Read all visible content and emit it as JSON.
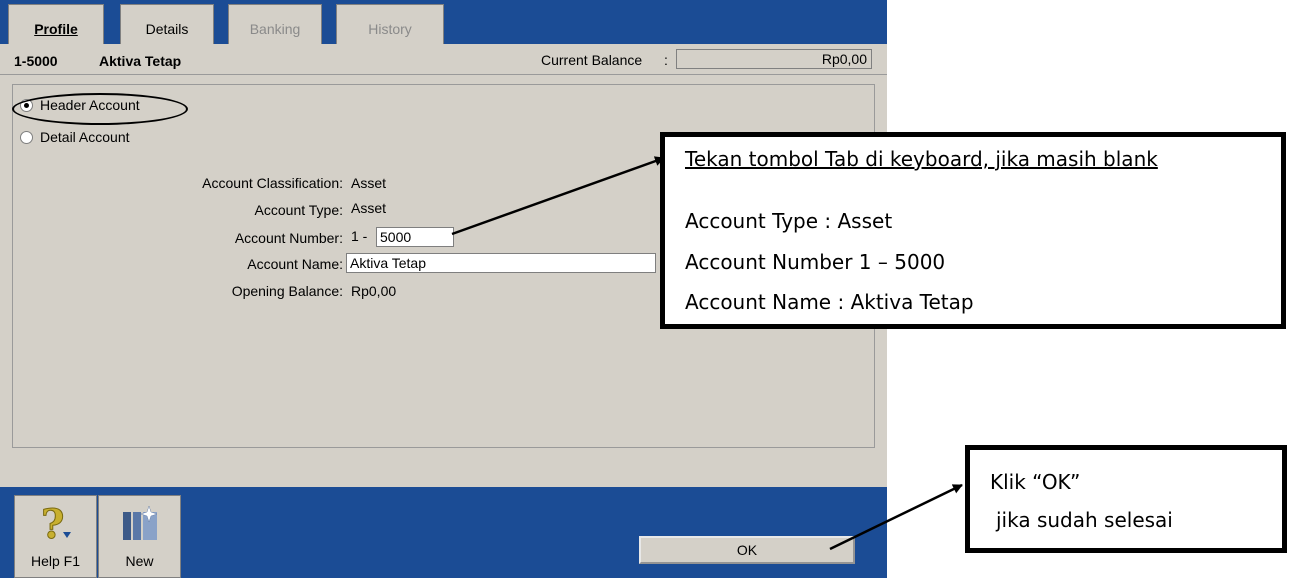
{
  "tabs": [
    {
      "label": "Profile",
      "state": "active"
    },
    {
      "label": "Details",
      "state": "enabled"
    },
    {
      "label": "Banking",
      "state": "disabled"
    },
    {
      "label": "History",
      "state": "disabled"
    }
  ],
  "account": {
    "code": "1-5000",
    "title": "Aktiva Tetap",
    "balance_label": "Current Balance",
    "balance_colon": ":",
    "balance_value": "Rp0,00"
  },
  "radio": {
    "header_label": "Header Account",
    "detail_label": "Detail Account",
    "selected": "header"
  },
  "form": {
    "classification_label": "Account Classification:",
    "classification_value": "Asset",
    "type_label": "Account Type:",
    "type_value": "Asset",
    "number_label": "Account Number:",
    "number_prefix": "1 -",
    "number_value": "5000",
    "name_label": "Account Name:",
    "name_value": "Aktiva Tetap",
    "opening_label": "Opening Balance:",
    "opening_value": "Rp0,00"
  },
  "toolbar": {
    "help_label": "Help F1",
    "new_label": "New",
    "ok_label": "OK"
  },
  "callouts": {
    "main_heading": "Tekan tombol Tab di keyboard, jika masih blank",
    "main_line1": "Account Type : Asset",
    "main_line2": "Account Number 1 – 5000",
    "main_line3": "Account Name : Aktiva Tetap",
    "ok_line1": "Klik “OK”",
    "ok_line2": "jika sudah selesai"
  },
  "colors": {
    "window_blue": "#1b4c95",
    "face": "#d4d0c8"
  }
}
